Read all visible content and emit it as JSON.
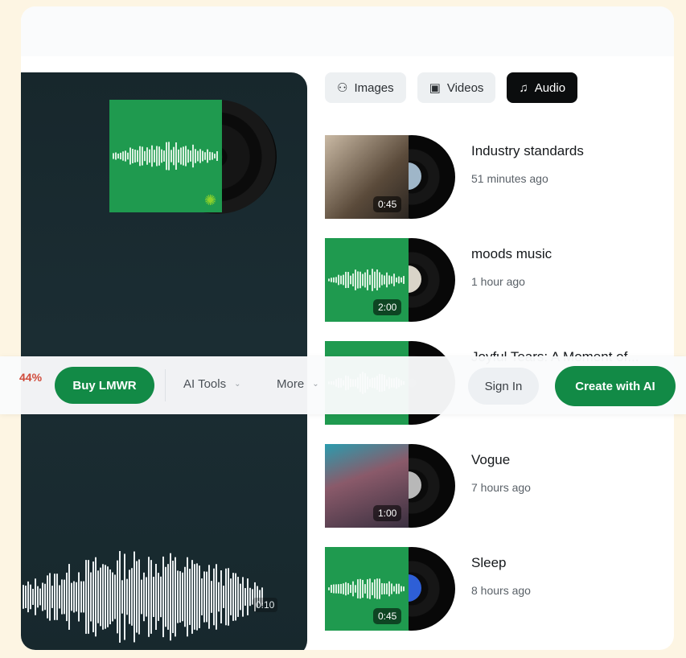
{
  "tabs": [
    {
      "label": "Images",
      "icon": "people-icon"
    },
    {
      "label": "Videos",
      "icon": "video-icon"
    },
    {
      "label": "Audio",
      "icon": "music-note-icon",
      "active": true
    }
  ],
  "player": {
    "time": "0:10"
  },
  "tracks": [
    {
      "title": "Industry standards",
      "time": "51 minutes ago",
      "duration": "0:45",
      "thumb": "photo"
    },
    {
      "title": "moods music",
      "time": "1 hour ago",
      "duration": "2:00",
      "thumb": "waveform"
    },
    {
      "title": "Joyful Tears: A Moment of...",
      "time": "",
      "duration": "",
      "thumb": "waveform"
    },
    {
      "title": "Vogue",
      "time": "7 hours ago",
      "duration": "1:00",
      "thumb": "photo"
    },
    {
      "title": "Sleep",
      "time": "8 hours ago",
      "duration": "0:45",
      "thumb": "waveform"
    }
  ],
  "navbar": {
    "percent": "44%",
    "buy_label": "Buy LMWR",
    "ai_tools_label": "AI Tools",
    "more_label": "More",
    "signin_label": "Sign In",
    "create_label": "Create with AI"
  },
  "colors": {
    "accent": "#128a46",
    "player_bg": "#17272c"
  }
}
